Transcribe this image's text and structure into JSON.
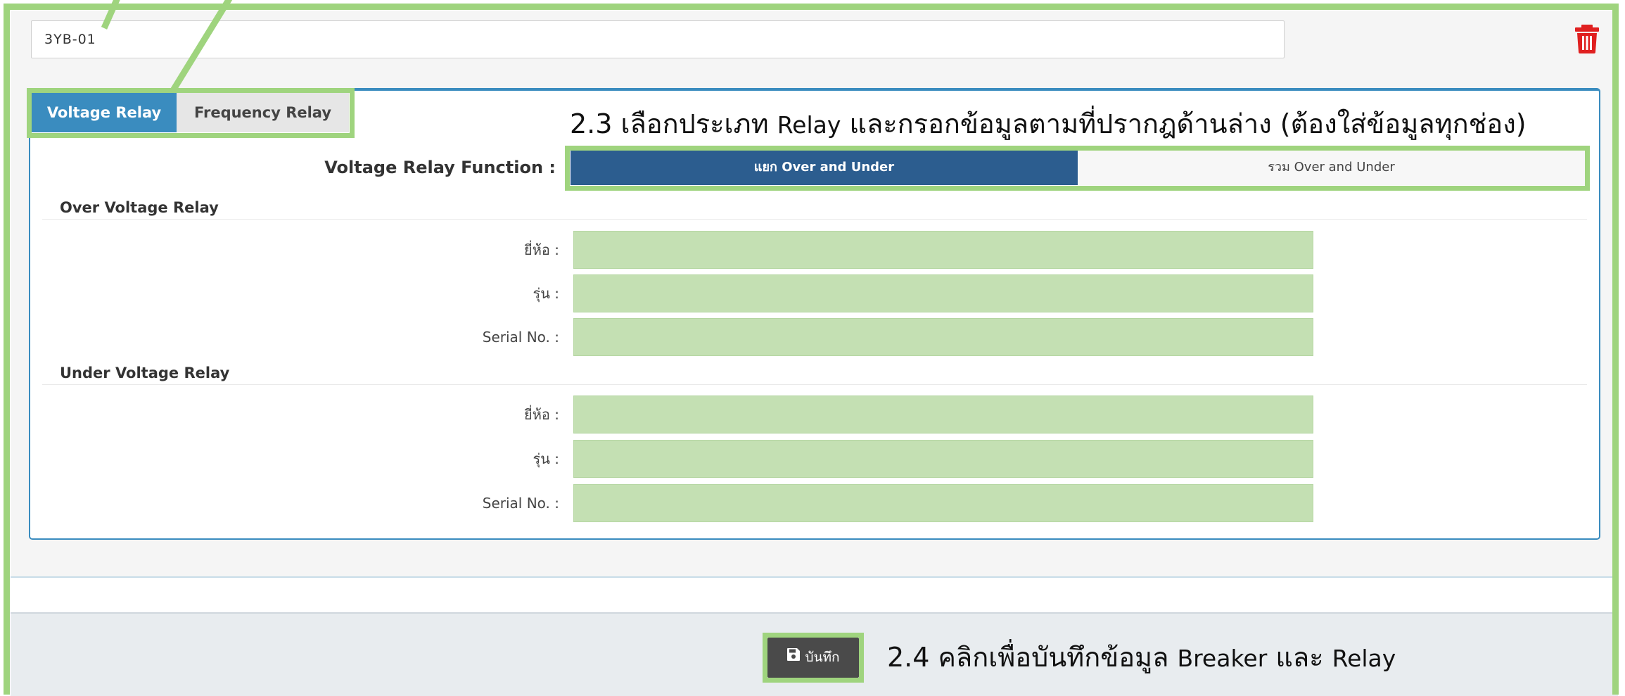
{
  "breaker": {
    "code": "3YB-01"
  },
  "icons": {
    "trash": "trash-icon",
    "save": "floppy-disk-icon"
  },
  "colors": {
    "accent": "#3a8cbf",
    "segment_active": "#2c5d8f",
    "field_fill": "#c4e0b3",
    "annotation": "#9fd47e",
    "trash": "#e02020"
  },
  "tabs": [
    {
      "label": "Voltage Relay",
      "active": true
    },
    {
      "label": "Frequency Relay",
      "active": false
    }
  ],
  "instructions": {
    "step_23_prefix": "2.3 เลือกประเภท ",
    "step_23_word": "Relay",
    "step_23_suffix": " และกรอกข้อมูลตามที่ปรากฎด้านล่าง (ต้องใส่ข้อมูลทุกช่อง)",
    "step_24_prefix": "2.4 คลิกเพื่อบันทึกข้อมูล ",
    "step_24_word1": "Breaker",
    "step_24_mid": " และ ",
    "step_24_word2": "Relay"
  },
  "function": {
    "label": "Voltage Relay Function :",
    "options": [
      {
        "label": "แยก Over and Under",
        "selected": true
      },
      {
        "label": "รวม Over and Under",
        "selected": false
      }
    ]
  },
  "sections": [
    {
      "title": "Over Voltage Relay",
      "fields": [
        {
          "label": "ยี่ห้อ :",
          "value": ""
        },
        {
          "label": "รุ่น :",
          "value": ""
        },
        {
          "label": "Serial No. :",
          "value": ""
        }
      ]
    },
    {
      "title": "Under Voltage Relay",
      "fields": [
        {
          "label": "ยี่ห้อ :",
          "value": ""
        },
        {
          "label": "รุ่น :",
          "value": ""
        },
        {
          "label": "Serial No. :",
          "value": ""
        }
      ]
    }
  ],
  "footer": {
    "save_label": "บันทึก"
  }
}
